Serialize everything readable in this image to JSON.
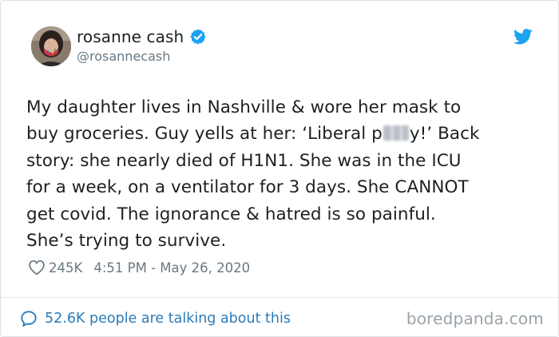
{
  "author": {
    "display_name": "rosanne cash",
    "handle": "@rosannecash",
    "verified": true,
    "avatar_icon": "profile-photo"
  },
  "platform_icon": "twitter-bird-icon",
  "tweet": {
    "lines": [
      "My daughter lives in Nashville & wore her mask to",
      "buy groceries. Guy yells at her: ‘Liberal p",
      "y!’ Back",
      "story: she nearly died of H1N1. She was in the ICU",
      "for a week, on a ventilator for 3 days. She CANNOT",
      "get covid. The ignorance & hatred is so painful.",
      "She’s trying to survive."
    ]
  },
  "meta": {
    "likes": "245K",
    "timestamp": "4:51 PM - May 26, 2020"
  },
  "footer": {
    "talking_text": "52.6K people are talking about this"
  },
  "watermark": "boredpanda.com",
  "colors": {
    "text": "#1c2022",
    "secondary": "#697882",
    "link": "#2b7bb9",
    "verified": "#1da1f2",
    "twitter_blue": "#1da1f2",
    "watermark": "#9aa3aa"
  }
}
